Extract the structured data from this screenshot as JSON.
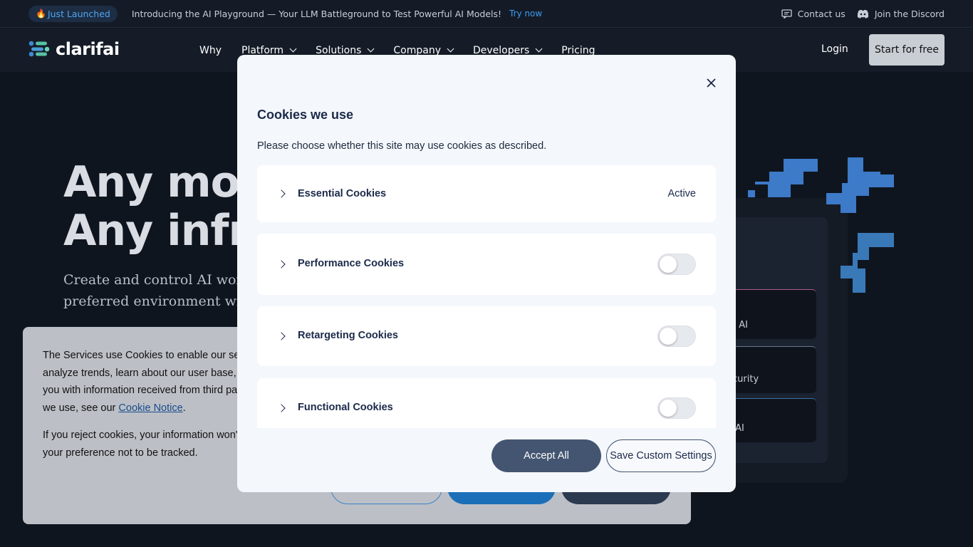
{
  "announcement": {
    "badge": "Just Launched",
    "text": "Introducing the AI Playground — Your LLM Battleground to Test Powerful AI Models!",
    "link": "Try now",
    "contact": "Contact us",
    "discord": "Join the Discord"
  },
  "nav": {
    "logo": "clarifai",
    "links": [
      "Why",
      "Platform",
      "Solutions",
      "Company",
      "Developers",
      "Pricing"
    ],
    "login": "Login",
    "cta": "Start for free"
  },
  "hero": {
    "title_line1": "Any mode",
    "title_line2": "Any infras",
    "sub_line1": "Create and control AI workloa",
    "sub_line2": "preferred environment with a u"
  },
  "graphic": {
    "cards": [
      "re AI",
      "ecurity",
      "e AI"
    ]
  },
  "banner": {
    "p1_before_link": "The Services use Cookies to enable our serv analyze trends, learn about our user base, a you with information received from third part we use, see our ",
    "p1_link": "Cookie Notice",
    "p1_after_link": ".",
    "p2": "If you reject cookies, your information won't your preference not to be tracked."
  },
  "modal": {
    "title": "Cookies we use",
    "description": "Please choose whether this site may use cookies as described.",
    "categories": [
      {
        "label": "Essential Cookies",
        "status": "Active"
      },
      {
        "label": "Performance Cookies"
      },
      {
        "label": "Retargeting Cookies"
      },
      {
        "label": "Functional Cookies"
      }
    ],
    "accept_all": "Accept All",
    "save_custom": "Save Custom Settings"
  },
  "colors": {
    "accent": "#435570",
    "brand_blue": "#3d7ac8",
    "page_bg": "#0f151f"
  }
}
